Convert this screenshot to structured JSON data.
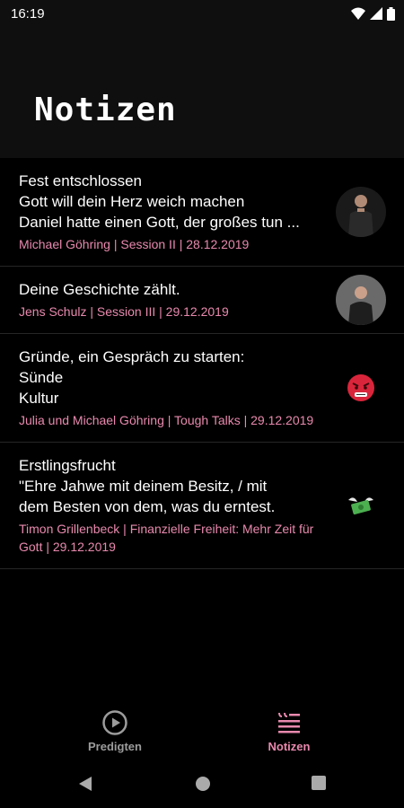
{
  "status_bar": {
    "time": "16:19"
  },
  "header": {
    "title": "Notizen"
  },
  "notes": [
    {
      "lines": [
        "Fest entschlossen",
        "Gott will dein Herz weich machen",
        "Daniel hatte einen Gott, der großes tun ..."
      ],
      "meta": "Michael Göhring | Session II | 28.12.2019",
      "thumbnail": "speaker-photo"
    },
    {
      "lines": [
        "Deine Geschichte zählt."
      ],
      "meta": "Jens Schulz | Session III | 29.12.2019",
      "thumbnail": "speaker-photo"
    },
    {
      "lines": [
        "Gründe, ein Gespräch zu starten:",
        "Sünde",
        "Kultur"
      ],
      "meta": "Julia und Michael Göhring | Tough Talks | 29.12.2019",
      "thumbnail": "angry-face-emoji"
    },
    {
      "lines": [
        "Erstlingsfrucht",
        "\"Ehre Jahwe mit deinem Besitz, / mit",
        "dem Besten von dem, was du erntest."
      ],
      "meta": "Timon Grillenbeck | Finanzielle Freiheit: Mehr Zeit für Gott | 29.12.2019",
      "thumbnail": "money-with-wings-emoji"
    }
  ],
  "bottom_nav": {
    "items": [
      {
        "label": "Predigten",
        "icon": "play-circle-icon",
        "active": false
      },
      {
        "label": "Notizen",
        "icon": "notes-icon",
        "active": true
      }
    ]
  },
  "colors": {
    "accent": "#e889ad",
    "background": "#000000",
    "header": "#0f0f0f",
    "inactive": "#9c9c9c"
  }
}
